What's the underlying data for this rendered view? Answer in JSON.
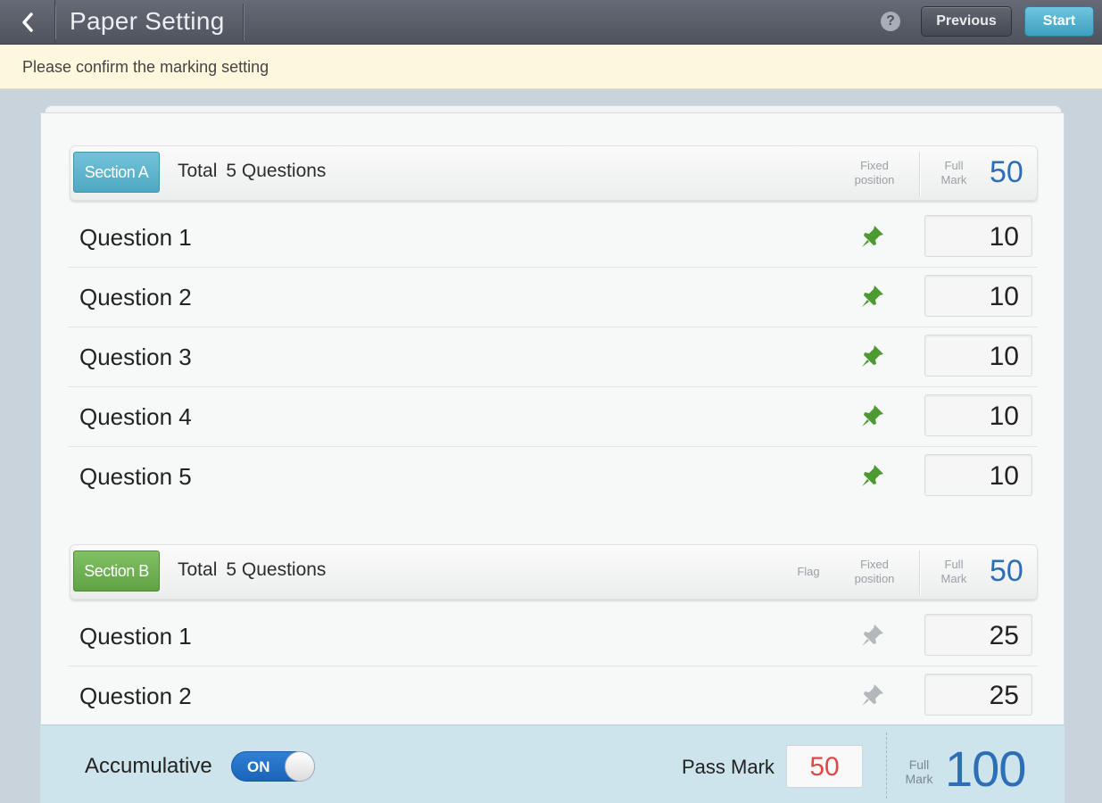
{
  "header": {
    "title": "Paper Setting",
    "help_icon": "?",
    "previous_label": "Previous",
    "start_label": "Start"
  },
  "notice": "Please confirm the marking setting",
  "sections": [
    {
      "badge": "Section A",
      "badge_color": "#5bb3cc",
      "total_label": "Total",
      "total_questions": "5 Questions",
      "flag_label": "",
      "fixed_label_1": "Fixed",
      "fixed_label_2": "position",
      "full_label_1": "Full",
      "full_label_2": "Mark",
      "full_mark": "50",
      "questions": [
        {
          "label": "Question 1",
          "score": "10",
          "pinned": true
        },
        {
          "label": "Question 2",
          "score": "10",
          "pinned": true
        },
        {
          "label": "Question 3",
          "score": "10",
          "pinned": true
        },
        {
          "label": "Question 4",
          "score": "10",
          "pinned": true
        },
        {
          "label": "Question 5",
          "score": "10",
          "pinned": true
        }
      ]
    },
    {
      "badge": "Section B",
      "badge_color": "#6db451",
      "total_label": "Total",
      "total_questions": "5 Questions",
      "flag_label": "Flag",
      "fixed_label_1": "Fixed",
      "fixed_label_2": "position",
      "full_label_1": "Full",
      "full_label_2": "Mark",
      "full_mark": "50",
      "questions": [
        {
          "label": "Question 1",
          "score": "25",
          "pinned": false
        },
        {
          "label": "Question 2",
          "score": "25",
          "pinned": false
        }
      ]
    }
  ],
  "footer": {
    "accumulative_label": "Accumulative",
    "toggle_state": "ON",
    "pass_mark_label": "Pass Mark",
    "pass_mark": "50",
    "full_label_1": "Full",
    "full_label_2": "Mark",
    "full_mark": "100"
  },
  "colors": {
    "pin_active": "#4e9a32",
    "pin_inactive": "#b4b8bc",
    "mark_blue": "#2d6fb7",
    "pass_red": "#e04848"
  }
}
